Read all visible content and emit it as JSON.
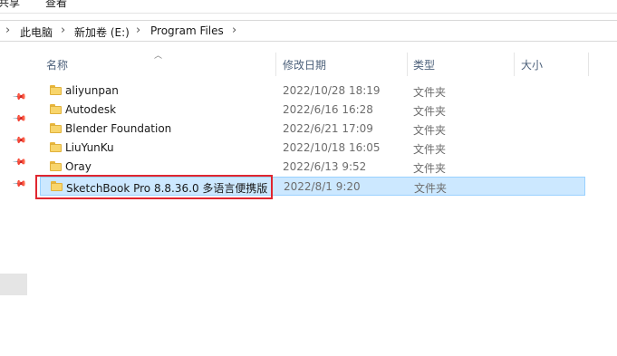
{
  "ribbon": {
    "tab_share": "共享",
    "tab_view": "查看"
  },
  "breadcrumb": {
    "items": [
      "此电脑",
      "新加卷 (E:)",
      "Program Files"
    ]
  },
  "columns": {
    "name": "名称",
    "date": "修改日期",
    "type": "类型",
    "size": "大小"
  },
  "files": [
    {
      "name": "aliyunpan",
      "date": "2022/10/28 18:19",
      "type": "文件夹",
      "icon": "folder-icon"
    },
    {
      "name": "Autodesk",
      "date": "2022/6/16 16:28",
      "type": "文件夹",
      "icon": "folder-icon"
    },
    {
      "name": "Blender Foundation",
      "date": "2022/6/21 17:09",
      "type": "文件夹",
      "icon": "folder-icon"
    },
    {
      "name": "LiuYunKu",
      "date": "2022/10/18 16:05",
      "type": "文件夹",
      "icon": "folder-icon"
    },
    {
      "name": "Oray",
      "date": "2022/6/13 9:52",
      "type": "文件夹",
      "icon": "folder-icon"
    },
    {
      "name": "SketchBook Pro 8.8.36.0 多语言便携版",
      "date": "2022/8/1 9:20",
      "type": "文件夹",
      "icon": "folder-icon",
      "selected": true
    }
  ],
  "colors": {
    "selection_bg": "#cce8ff",
    "selection_border": "#99d1ff",
    "highlight_box": "#e0262f",
    "folder": "#f8d56b"
  }
}
